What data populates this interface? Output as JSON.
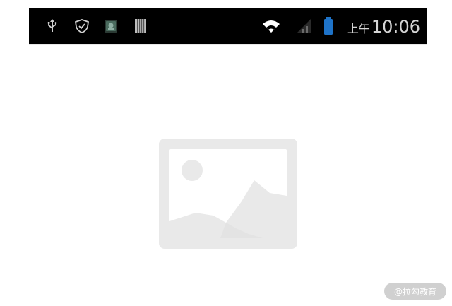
{
  "status_bar": {
    "icons": [
      "usb-icon",
      "shield-icon",
      "app-icon",
      "barcode-icon",
      "wifi-icon",
      "signal-icon",
      "battery-icon"
    ],
    "clock_period": "上午",
    "clock_time": "10:06",
    "background": "#000000",
    "battery_color": "#1e73c8"
  },
  "main": {
    "placeholder_icon": "image-placeholder-icon",
    "placeholder_color": "#e8e8e8"
  },
  "watermark": {
    "text": "@拉勾教育"
  }
}
